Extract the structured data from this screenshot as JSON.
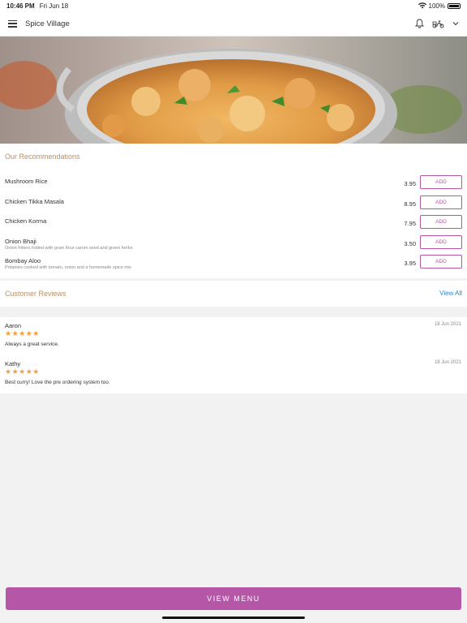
{
  "status_bar": {
    "time": "10:46 PM",
    "date": "Fri Jun 18",
    "battery": "100%"
  },
  "header": {
    "title": "Spice Village",
    "icons": [
      "menu-icon",
      "bell-icon",
      "scooter-icon",
      "chevron-down-icon"
    ]
  },
  "hero": {
    "image": "curry-dish-photo",
    "colors": {
      "bowl": "#c9c9c9",
      "curry": "#d98a3a",
      "background": "#8a7a6a"
    }
  },
  "recommendations": {
    "title": "Our Recommendations",
    "add_label": "ADD",
    "items": [
      {
        "name": "Mushroom Rice",
        "description": "",
        "price": "3.95"
      },
      {
        "name": "Chicken Tikka Masala",
        "description": "",
        "price": "8.95"
      },
      {
        "name": "Chicken Korma",
        "description": "",
        "price": "7.95"
      },
      {
        "name": "Onion Bhaji",
        "description": "Onion fritters folded with gram flour carom seed and green herbs",
        "price": "3.50"
      },
      {
        "name": "Bombay Aloo",
        "description": "Potatoes cooked with tomato, onion and a homemade spice mix",
        "price": "3.95"
      }
    ]
  },
  "reviews": {
    "title": "Customer Reviews",
    "view_all": "View All",
    "items": [
      {
        "author": "Aaron",
        "date": "18 Jun 2021",
        "rating": 5,
        "stars": "★★★★★",
        "text": "Always a great service."
      },
      {
        "author": "Kathy",
        "date": "18 Jun 2021",
        "rating": 5,
        "stars": "★★★★★",
        "text": "Best curry! Love the pre ordering system too."
      }
    ]
  },
  "footer": {
    "view_menu_label": "VIEW MENU"
  },
  "colors": {
    "accent": "#b556a7",
    "section_title": "#b5906a",
    "link": "#2d8ac7",
    "star": "#f0a03c"
  }
}
